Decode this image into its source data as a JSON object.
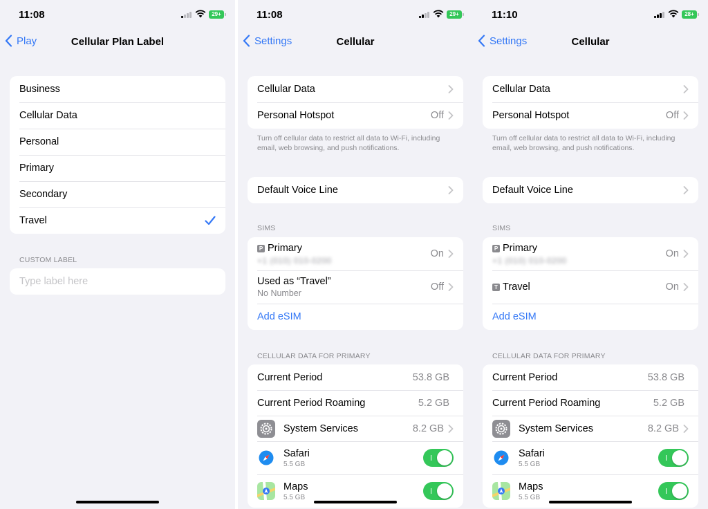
{
  "screens": [
    {
      "time": "11:08",
      "battery": "29+",
      "back_label": "Play",
      "title": "Cellular Plan Label",
      "labels": [
        {
          "label": "Business",
          "checked": false
        },
        {
          "label": "Cellular Data",
          "checked": false
        },
        {
          "label": "Personal",
          "checked": false
        },
        {
          "label": "Primary",
          "checked": false
        },
        {
          "label": "Secondary",
          "checked": false
        },
        {
          "label": "Travel",
          "checked": true
        }
      ],
      "custom_header": "CUSTOM LABEL",
      "custom_placeholder": "Type label here"
    },
    {
      "time": "11:08",
      "battery": "29+",
      "back_label": "Settings",
      "title": "Cellular",
      "cellular_data_label": "Cellular Data",
      "hotspot_label": "Personal Hotspot",
      "hotspot_value": "Off",
      "footer_text": "Turn off cellular data to restrict all data to Wi-Fi, including email, web browsing, and push notifications.",
      "voice_line_label": "Default Voice Line",
      "sims_header": "SIMs",
      "sim1": {
        "badge": "P",
        "name": "Primary",
        "number": "+1 (010) 010-0200",
        "value": "On"
      },
      "sim2": {
        "name": "Used as “Travel”",
        "sub": "No Number",
        "value": "Off"
      },
      "add_esim": "Add eSIM",
      "usage_header": "CELLULAR DATA FOR PRIMARY",
      "current_period_label": "Current Period",
      "current_period_value": "53.8 GB",
      "roaming_label": "Current Period Roaming",
      "roaming_value": "5.2 GB",
      "system_services_label": "System Services",
      "system_services_value": "8.2 GB",
      "safari": {
        "name": "Safari",
        "usage": "5.5 GB",
        "enabled": true
      },
      "maps": {
        "name": "Maps",
        "usage": "5.5 GB",
        "enabled": true
      }
    },
    {
      "time": "11:10",
      "battery": "28+",
      "back_label": "Settings",
      "title": "Cellular",
      "cellular_data_label": "Cellular Data",
      "hotspot_label": "Personal Hotspot",
      "hotspot_value": "Off",
      "footer_text": "Turn off cellular data to restrict all data to Wi-Fi, including email, web browsing, and push notifications.",
      "voice_line_label": "Default Voice Line",
      "sims_header": "SIMs",
      "sim1": {
        "badge": "P",
        "name": "Primary",
        "number": "+1 (010) 010-0200",
        "value": "On"
      },
      "sim2": {
        "badge": "T",
        "name": "Travel",
        "value": "On"
      },
      "add_esim": "Add eSIM",
      "usage_header": "CELLULAR DATA FOR PRIMARY",
      "current_period_label": "Current Period",
      "current_period_value": "53.8 GB",
      "roaming_label": "Current Period Roaming",
      "roaming_value": "5.2 GB",
      "system_services_label": "System Services",
      "system_services_value": "8.2 GB",
      "safari": {
        "name": "Safari",
        "usage": "5.5 GB",
        "enabled": true
      },
      "maps": {
        "name": "Maps",
        "usage": "5.5 GB",
        "enabled": true
      }
    }
  ],
  "colors": {
    "accent": "#3478f6",
    "toggle_on": "#34c759",
    "background": "#f2f2f7"
  }
}
